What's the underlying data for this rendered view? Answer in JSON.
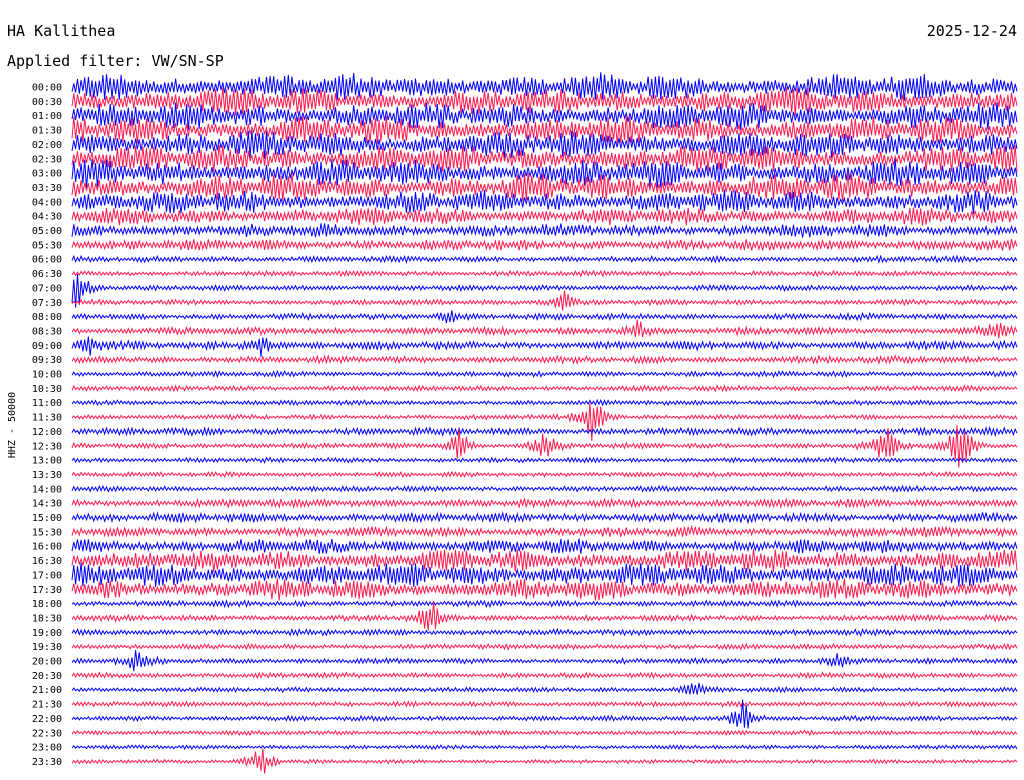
{
  "header": {
    "station": "HA Kallithea",
    "date": "2025-12-24",
    "filter": "Applied filter: VW/SN-SP"
  },
  "chart_data": {
    "type": "line",
    "title": "HA Kallithea",
    "subtitle": "Applied filter: VW/SN-SP",
    "date": "2025-12-24",
    "ylabel": "HHZ - 50000",
    "xlabel": "",
    "categories": [
      "00:00",
      "00:30",
      "01:00",
      "01:30",
      "02:00",
      "02:30",
      "03:00",
      "03:30",
      "04:00",
      "04:30",
      "05:00",
      "05:30",
      "06:00",
      "06:30",
      "07:00",
      "07:30",
      "08:00",
      "08:30",
      "09:00",
      "09:30",
      "10:00",
      "10:30",
      "11:00",
      "11:30",
      "12:00",
      "12:30",
      "13:00",
      "13:30",
      "14:00",
      "14:30",
      "15:00",
      "15:30",
      "16:00",
      "16:30",
      "17:00",
      "17:30",
      "18:00",
      "18:30",
      "19:00",
      "19:30",
      "20:00",
      "20:30",
      "21:00",
      "21:30",
      "22:00",
      "22:30",
      "23:00",
      "23:30"
    ],
    "series_colors": [
      "#0000ff",
      "#ff1a4d"
    ],
    "noise_level": [
      1.0,
      1.0,
      1.0,
      1.0,
      1.0,
      1.0,
      1.0,
      1.0,
      0.85,
      0.6,
      0.45,
      0.35,
      0.15,
      0.12,
      0.12,
      0.12,
      0.15,
      0.2,
      0.25,
      0.2,
      0.12,
      0.12,
      0.1,
      0.1,
      0.2,
      0.12,
      0.1,
      0.1,
      0.12,
      0.25,
      0.3,
      0.3,
      0.5,
      0.8,
      0.85,
      0.75,
      0.15,
      0.15,
      0.15,
      0.12,
      0.12,
      0.12,
      0.1,
      0.1,
      0.1,
      0.08,
      0.06,
      0.06
    ],
    "events": [
      {
        "row": 14,
        "x": 0.005,
        "amp": 3.0
      },
      {
        "row": 15,
        "x": 0.52,
        "amp": 1.5
      },
      {
        "row": 16,
        "x": 0.4,
        "amp": 1.2
      },
      {
        "row": 17,
        "x": 0.6,
        "amp": 1.5
      },
      {
        "row": 17,
        "x": 0.98,
        "amp": 1.5
      },
      {
        "row": 18,
        "x": 0.02,
        "amp": 1.2
      },
      {
        "row": 18,
        "x": 0.2,
        "amp": 1.3
      },
      {
        "row": 23,
        "x": 0.55,
        "amp": 3.5
      },
      {
        "row": 25,
        "x": 0.41,
        "amp": 2.2
      },
      {
        "row": 25,
        "x": 0.5,
        "amp": 1.8
      },
      {
        "row": 25,
        "x": 0.86,
        "amp": 3.0
      },
      {
        "row": 25,
        "x": 0.94,
        "amp": 4.0
      },
      {
        "row": 37,
        "x": 0.38,
        "amp": 2.5
      },
      {
        "row": 40,
        "x": 0.07,
        "amp": 1.8
      },
      {
        "row": 40,
        "x": 0.81,
        "amp": 1.2
      },
      {
        "row": 42,
        "x": 0.66,
        "amp": 1.0
      },
      {
        "row": 44,
        "x": 0.71,
        "amp": 2.5
      },
      {
        "row": 47,
        "x": 0.2,
        "amp": 2.5
      }
    ]
  }
}
